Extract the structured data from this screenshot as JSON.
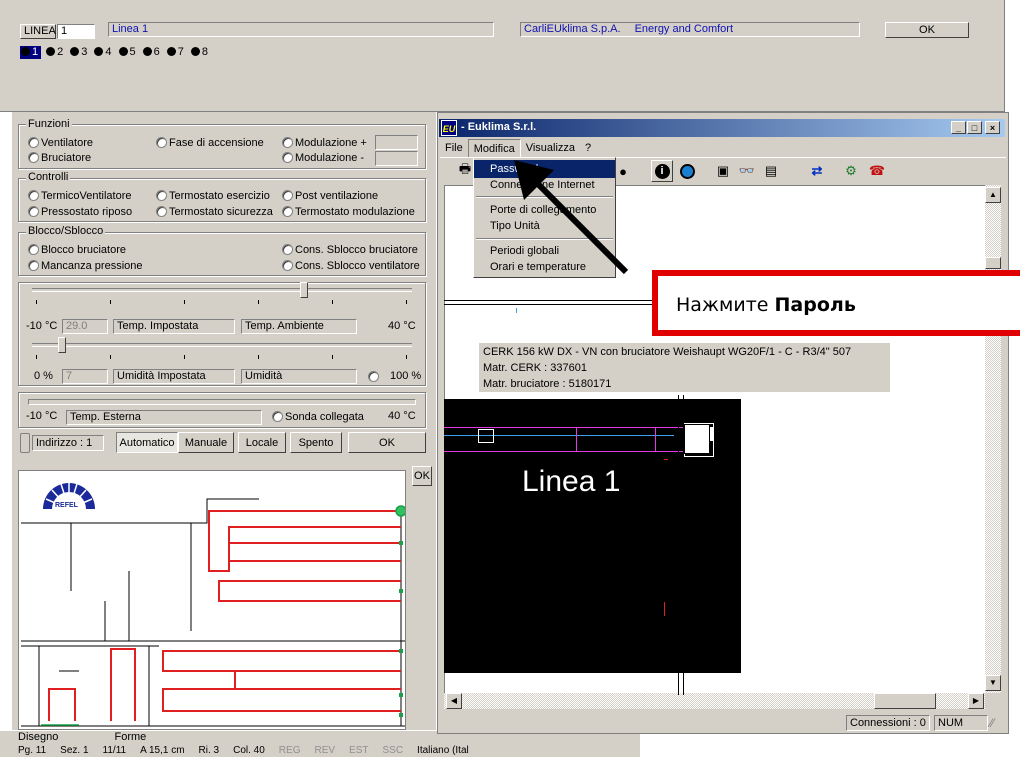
{
  "top": {
    "linea_label": "LINEA",
    "linea_value": "1",
    "linea_name": "Linea 1",
    "company": "CarliEUklima S.p.A.",
    "tagline": "Energy and Comfort",
    "ok_label": "OK",
    "line_selectors": [
      "1",
      "2",
      "3",
      "4",
      "5",
      "6",
      "7",
      "8"
    ]
  },
  "funzioni": {
    "title": "Funzioni",
    "ventilatore": "Ventilatore",
    "fase": "Fase di accensione",
    "mod_plus": "Modulazione +",
    "bruciatore": "Bruciatore",
    "mod_minus": "Modulazione -"
  },
  "controlli": {
    "title": "Controlli",
    "termico": "TermicoVentilatore",
    "term_esercizio": "Termostato esercizio",
    "post_vent": "Post ventilazione",
    "press_riposo": "Pressostato riposo",
    "term_sicurezza": "Termostato sicurezza",
    "term_modulazione": "Termostato modulazione"
  },
  "blocco": {
    "title": "Blocco/Sblocco",
    "blocco_bruc": "Blocco bruciatore",
    "cons_bruc": "Cons. Sblocco bruciatore",
    "mancanza": "Mancanza pressione",
    "cons_vent": "Cons. Sblocco ventilatore"
  },
  "temp": {
    "min": "-10 °C",
    "set_value": "29.0",
    "impostata": "Temp. Impostata",
    "ambiente": "Temp. Ambiente",
    "max": "40 °C",
    "slider_level": 0.72
  },
  "umid": {
    "min": "0 %",
    "set_value": "7",
    "impostata": "Umidità Impostata",
    "umidita": "Umidità",
    "max": "100 %",
    "slider_level": 0.07
  },
  "esterna": {
    "min": "-10 °C",
    "label": "Temp. Esterna",
    "sonda": "Sonda collegata",
    "max": "40 °C"
  },
  "bottom": {
    "indirizzo": "Indirizzo : 1",
    "automatico": "Automatico",
    "manuale": "Manuale",
    "locale": "Locale",
    "spento": "Spento",
    "ok": "OK",
    "map_ok": "OK"
  },
  "logo": {
    "text": "REFEL"
  },
  "euklima": {
    "title": "- Euklima S.r.l.",
    "menu": [
      "File",
      "Modifica",
      "Visualizza",
      "?"
    ],
    "dropdown": [
      "Password",
      "Connessione Internet",
      "Porte di collegamento",
      "Tipo Unità",
      "Periodi globali",
      "Orari e temperature"
    ],
    "info_lines": [
      "CERK 156 kW DX - VN con bruciatore Weishaupt WG20F/1 - C - R3/4\" 507",
      "Matr. CERK : 337601",
      "Matr. bruciatore : 5180171"
    ],
    "canvas_title": "Linea 1",
    "status_conn": "Connessioni : 0",
    "status_num": "NUM"
  },
  "callout": {
    "prefix": "Нажмите ",
    "bold": "Пароль"
  },
  "word": {
    "disegno": "Disegno",
    "forme": "Forme",
    "status": [
      "Pg. 11",
      "Sez. 1",
      "11/11",
      "A 15,1 cm",
      "Ri. 3",
      "Col. 40",
      "REG",
      "REV",
      "EST",
      "SSC",
      "Italiano (Ital"
    ]
  }
}
